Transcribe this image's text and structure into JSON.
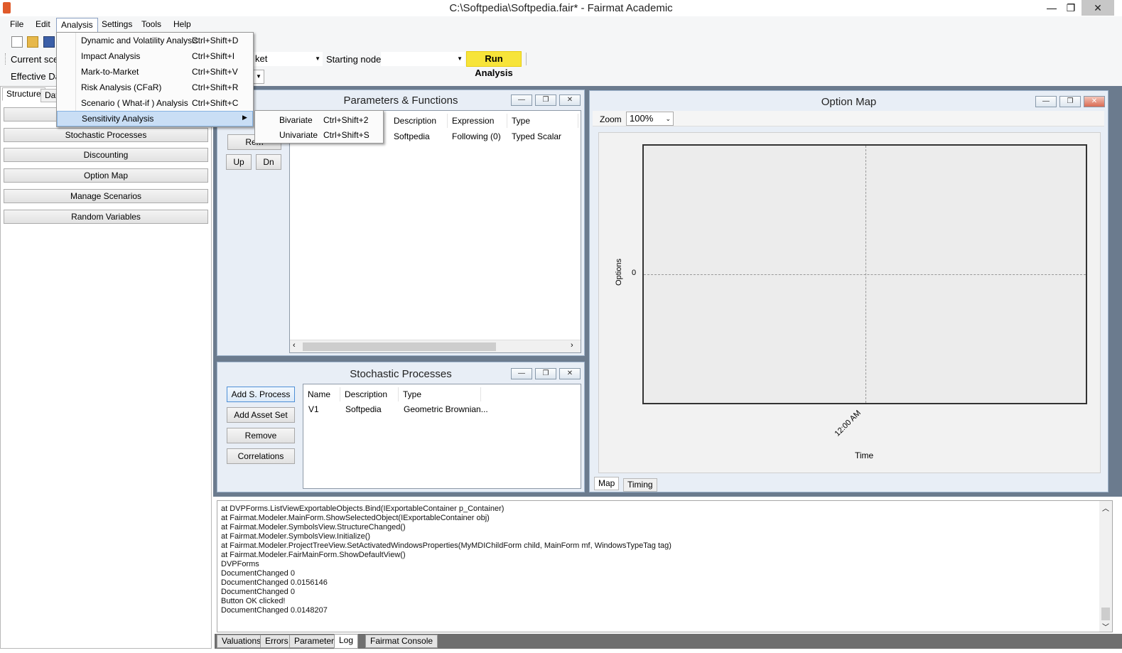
{
  "window": {
    "title": "C:\\Softpedia\\Softpedia.fair* - Fairmat Academic",
    "min_symbol": "—",
    "max_symbol": "❐",
    "close_symbol": "✕"
  },
  "menubar": [
    "File",
    "Edit",
    "Analysis",
    "Settings",
    "Tools",
    "Help"
  ],
  "toolbar": {
    "current_label": "Current scen",
    "current_value": "ket",
    "starting_node_label": "Starting node",
    "starting_node_value": "",
    "run_label": "Run Analysis",
    "effective_label": "Effective Dat"
  },
  "left_tabs": [
    "Structure",
    "Dat"
  ],
  "left_nav": [
    "Stochastic Processes",
    "Discounting",
    "Option Map",
    "Manage Scenarios",
    "Random Variables"
  ],
  "analysis_menu": [
    {
      "label": "Dynamic and Volatility Analysis",
      "shortcut": "Ctrl+Shift+D"
    },
    {
      "label": "Impact Analysis",
      "shortcut": "Ctrl+Shift+I"
    },
    {
      "label": "Mark-to-Market",
      "shortcut": "Ctrl+Shift+V"
    },
    {
      "label": "Risk Analysis (CFaR)",
      "shortcut": "Ctrl+Shift+R"
    },
    {
      "label": "Scenario ( What-if ) Analysis",
      "shortcut": "Ctrl+Shift+C"
    },
    {
      "label": "Sensitivity Analysis",
      "shortcut": ""
    }
  ],
  "sensitivity_submenu": [
    {
      "label": "Bivariate",
      "shortcut": "Ctrl+Shift+2"
    },
    {
      "label": "Univariate",
      "shortcut": "Ctrl+Shift+S"
    }
  ],
  "params_window": {
    "title": "Parameters & Functions",
    "buttons": {
      "remove": "Rem",
      "up": "Up",
      "down": "Dn"
    },
    "columns": [
      "Description",
      "Expression",
      "Type"
    ],
    "row": {
      "description": "Softpedia",
      "expression": "Following (0)",
      "type": "Typed Scalar"
    }
  },
  "stochastic_window": {
    "title": "Stochastic Processes",
    "buttons": [
      "Add S. Process",
      "Add Asset Set",
      "Remove",
      "Correlations"
    ],
    "columns": [
      "Name",
      "Description",
      "Type"
    ],
    "row": {
      "name": "V1",
      "description": "Softpedia",
      "type": "Geometric Brownian..."
    }
  },
  "option_map": {
    "title": "Option Map",
    "zoom_label": "Zoom",
    "zoom_value": "100%",
    "y_axis_label": "Options",
    "y_tick": "0",
    "x_tick": "12:00 AM",
    "x_axis_label": "Time",
    "tabs": [
      "Map",
      "Timing"
    ]
  },
  "log_lines": [
    "   at DVPForms.ListViewExportableObjects.Bind(IExportableContainer p_Container)",
    "   at Fairmat.Modeler.MainForm.ShowSelectedObject(IExportableContainer obj)",
    "   at Fairmat.Modeler.SymbolsView.StructureChanged()",
    "   at Fairmat.Modeler.SymbolsView.Initialize()",
    "   at Fairmat.Modeler.ProjectTreeView.SetActivatedWindowsProperties(MyMDIChildForm child, MainForm mf, WindowsTypeTag tag)",
    "   at Fairmat.Modeler.FairMainForm.ShowDefaultView()",
    "DVPForms",
    "DocumentChanged 0",
    "DocumentChanged 0.0156146",
    "DocumentChanged 0",
    "Button OK clicked!",
    "DocumentChanged 0.0148207"
  ],
  "bottom_tabs": [
    "Valuations",
    "Errors",
    "Parameters",
    "Log",
    "Fairmat Console"
  ],
  "colors": {
    "run_button": "#f7e43a",
    "mdi_background": "#6b7b8e",
    "menu_highlight": "#c9def5"
  }
}
